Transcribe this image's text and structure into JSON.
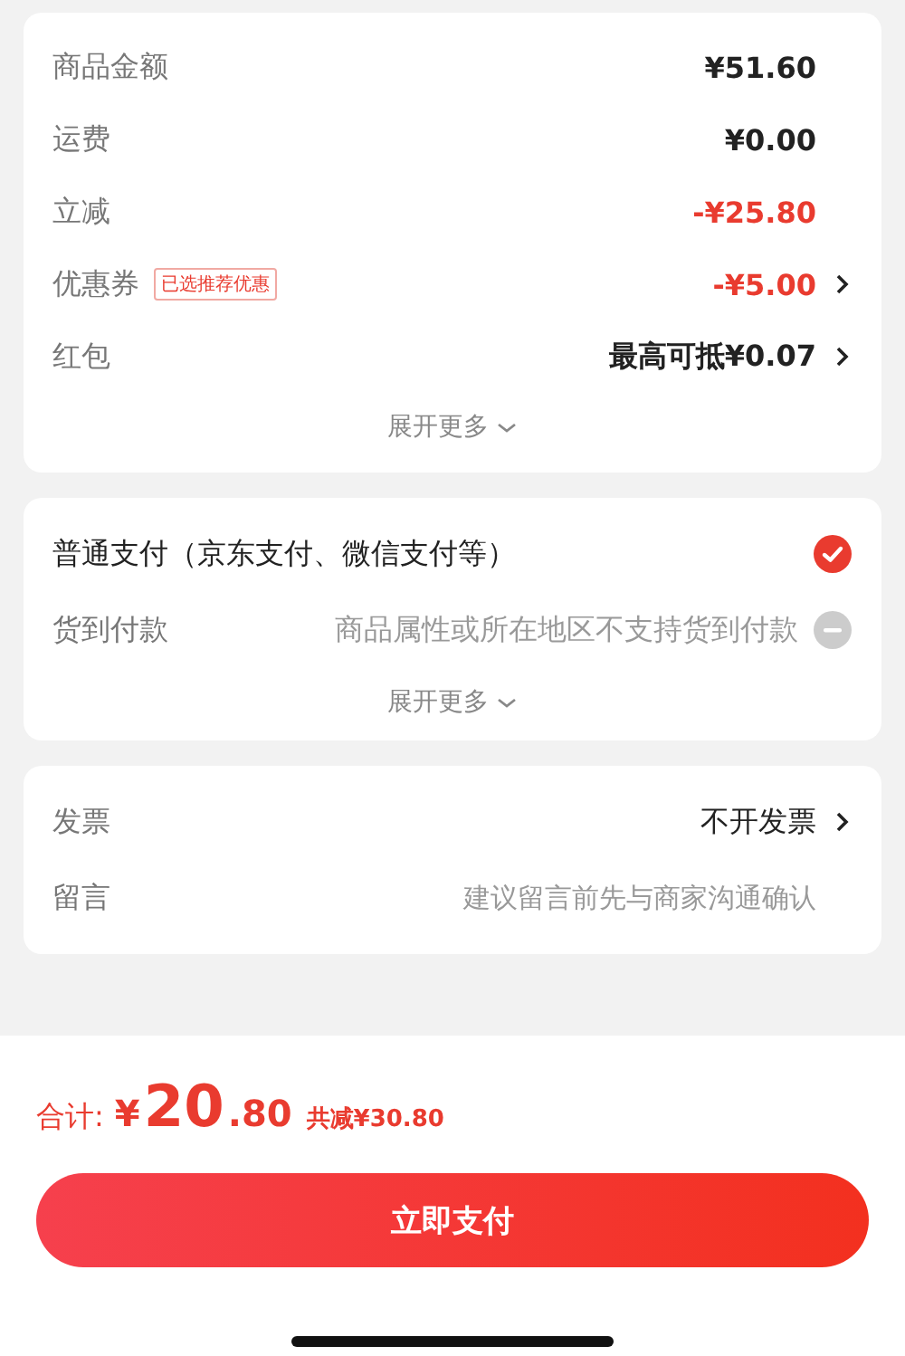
{
  "summary": {
    "rows": [
      {
        "label": "商品金额",
        "value": "¥51.60",
        "discount": false,
        "chevron": false
      },
      {
        "label": "运费",
        "value": "¥0.00",
        "discount": false,
        "chevron": false
      },
      {
        "label": "立减",
        "value": "-¥25.80",
        "discount": true,
        "chevron": false
      },
      {
        "label": "优惠券",
        "badge": "已选推荐优惠",
        "value": "-¥5.00",
        "discount": true,
        "chevron": true
      },
      {
        "label": "红包",
        "value": "最高可抵¥0.07",
        "discount": false,
        "chevron": true
      }
    ],
    "expand": "展开更多"
  },
  "payment": {
    "options": [
      {
        "label": "普通支付（京东支付、微信支付等）",
        "selected": true,
        "disabled": false
      },
      {
        "label": "货到付款",
        "note": "商品属性或所在地区不支持货到付款",
        "selected": false,
        "disabled": true
      }
    ],
    "expand": "展开更多"
  },
  "extras": {
    "invoice": {
      "label": "发票",
      "value": "不开发票"
    },
    "message": {
      "label": "留言",
      "placeholder": "建议留言前先与商家沟通确认"
    }
  },
  "footer": {
    "total_label": "合计:",
    "currency": "¥",
    "integer": "20",
    "decimal": ".80",
    "saving": "共减¥30.80",
    "button": "立即支付"
  }
}
